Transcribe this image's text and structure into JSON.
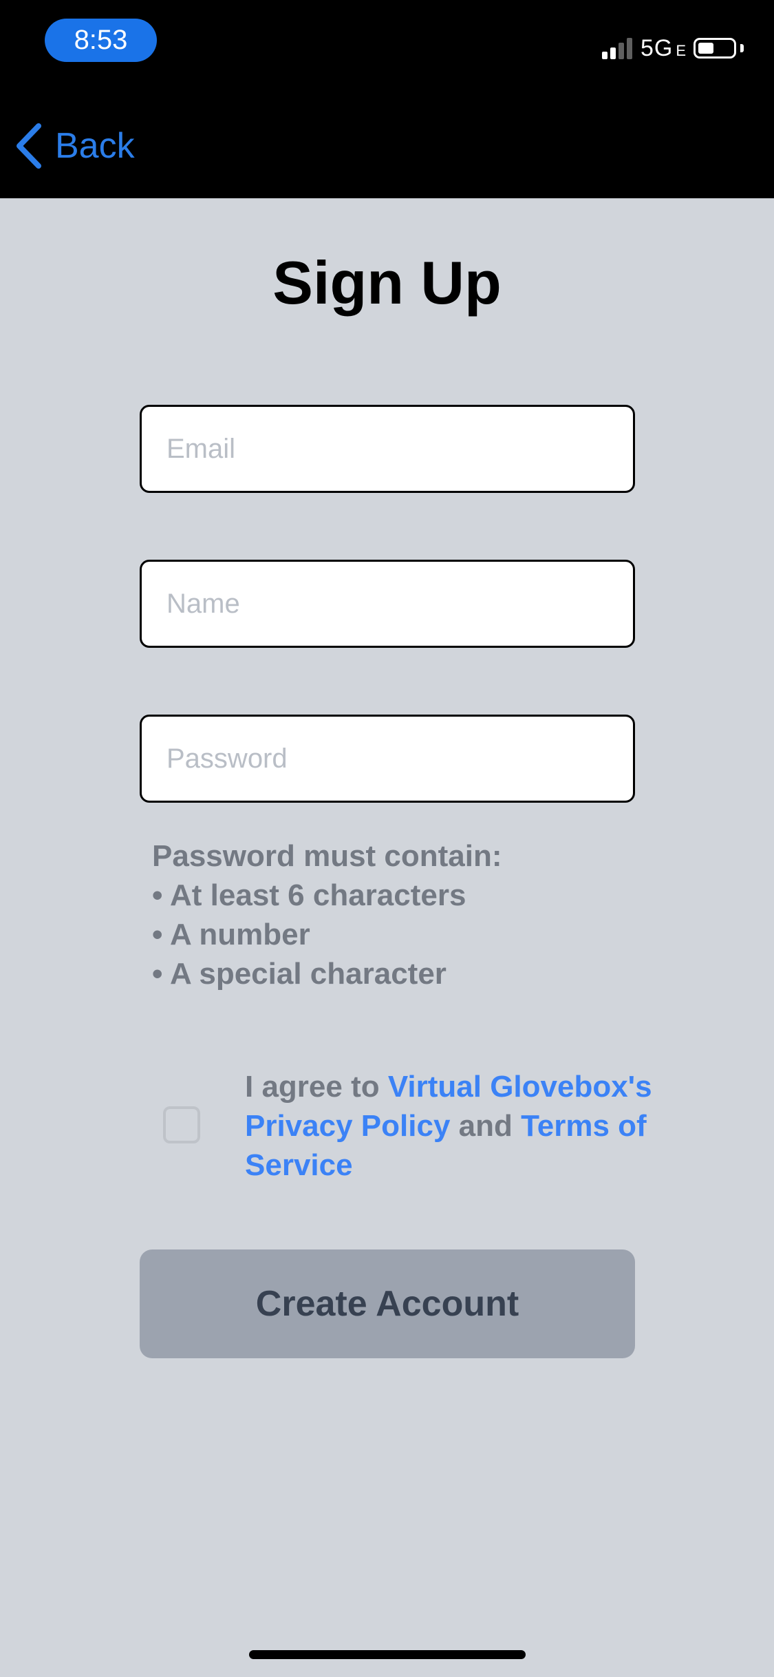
{
  "status_bar": {
    "time": "8:53",
    "network": "5G",
    "network_sub": "E",
    "signal_bars_active": 2,
    "signal_bars_total": 4,
    "battery_level": 0.45
  },
  "nav": {
    "back_label": "Back"
  },
  "title": "Sign Up",
  "fields": {
    "email": {
      "placeholder": "Email",
      "value": ""
    },
    "name": {
      "placeholder": "Name",
      "value": ""
    },
    "password": {
      "placeholder": "Password",
      "value": ""
    }
  },
  "password_requirements": {
    "heading": "Password must contain:",
    "items": [
      "• At least 6 characters",
      "• A number",
      "• A special character"
    ]
  },
  "agreement": {
    "checked": false,
    "prefix": "I agree to ",
    "privacy_link": "Virtual Glovebox's Privacy Policy",
    "conjunction": " and ",
    "terms_link": "Terms of Service"
  },
  "create_button_label": "Create Account",
  "colors": {
    "accent": "#2b7de9",
    "link": "#3b82f6",
    "background": "#d1d5db",
    "hint_text": "#737983",
    "button_disabled": "#9ca3af",
    "time_pill": "#1a73e8"
  }
}
